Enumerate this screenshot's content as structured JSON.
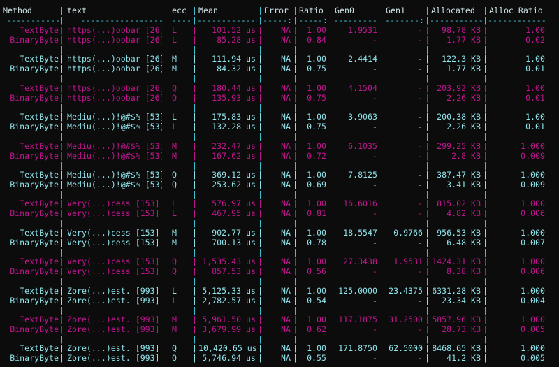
{
  "colors": {
    "background": "#0c0c0c",
    "cyan": "#8fe3ea",
    "magenta": "#c0168e",
    "separator": "#3fc5d0",
    "header": "#cfe3e6"
  },
  "header": [
    "Method",
    "text",
    "ecc",
    "Mean",
    "Error",
    "Ratio",
    "Gen0",
    "Gen1",
    "Allocated",
    "Alloc Ratio"
  ],
  "divider": [
    "-----------",
    "-----------------",
    "----",
    "-------------:",
    "-----:",
    "-----:",
    "---------:",
    "-------:",
    "-----------:",
    "------------:"
  ],
  "groups": [
    {
      "color": "magenta",
      "rows": [
        [
          "TextByte",
          "https(...)oobar [26]",
          "L",
          "101.52 us",
          "NA",
          "1.00",
          "1.9531",
          "-",
          "98.78 KB",
          "1.00"
        ],
        [
          "BinaryByte",
          "https(...)oobar [26]",
          "L",
          "85.28 us",
          "NA",
          "0.84",
          "-",
          "-",
          "1.77 KB",
          "0.02"
        ]
      ]
    },
    {
      "color": "cyan",
      "rows": [
        [
          "TextByte",
          "https(...)oobar [26]",
          "M",
          "111.94 us",
          "NA",
          "1.00",
          "2.4414",
          "-",
          "122.3 KB",
          "1.00"
        ],
        [
          "BinaryByte",
          "https(...)oobar [26]",
          "M",
          "84.32 us",
          "NA",
          "0.75",
          "-",
          "-",
          "1.77 KB",
          "0.01"
        ]
      ]
    },
    {
      "color": "magenta",
      "rows": [
        [
          "TextByte",
          "https(...)oobar [26]",
          "Q",
          "180.44 us",
          "NA",
          "1.00",
          "4.1504",
          "-",
          "203.92 KB",
          "1.00"
        ],
        [
          "BinaryByte",
          "https(...)oobar [26]",
          "Q",
          "135.93 us",
          "NA",
          "0.75",
          "-",
          "-",
          "2.26 KB",
          "0.01"
        ]
      ]
    },
    {
      "color": "cyan",
      "rows": [
        [
          "TextByte",
          "Mediu(...)!@#$% [53]",
          "L",
          "175.83 us",
          "NA",
          "1.00",
          "3.9063",
          "-",
          "200.38 KB",
          "1.00"
        ],
        [
          "BinaryByte",
          "Mediu(...)!@#$% [53]",
          "L",
          "132.28 us",
          "NA",
          "0.75",
          "-",
          "-",
          "2.26 KB",
          "0.01"
        ]
      ]
    },
    {
      "color": "magenta",
      "rows": [
        [
          "TextByte",
          "Mediu(...)!@#$% [53]",
          "M",
          "232.47 us",
          "NA",
          "1.00",
          "6.1035",
          "-",
          "299.25 KB",
          "1.000"
        ],
        [
          "BinaryByte",
          "Mediu(...)!@#$% [53]",
          "M",
          "167.62 us",
          "NA",
          "0.72",
          "-",
          "-",
          "2.8 KB",
          "0.009"
        ]
      ]
    },
    {
      "color": "cyan",
      "rows": [
        [
          "TextByte",
          "Mediu(...)!@#$% [53]",
          "Q",
          "369.12 us",
          "NA",
          "1.00",
          "7.8125",
          "-",
          "387.47 KB",
          "1.000"
        ],
        [
          "BinaryByte",
          "Mediu(...)!@#$% [53]",
          "Q",
          "253.62 us",
          "NA",
          "0.69",
          "-",
          "-",
          "3.41 KB",
          "0.009"
        ]
      ]
    },
    {
      "color": "magenta",
      "rows": [
        [
          "TextByte",
          "Very(...)cess [153]",
          "L",
          "576.97 us",
          "NA",
          "1.00",
          "16.6016",
          "-",
          "815.02 KB",
          "1.000"
        ],
        [
          "BinaryByte",
          "Very(...)cess [153]",
          "L",
          "467.95 us",
          "NA",
          "0.81",
          "-",
          "-",
          "4.82 KB",
          "0.006"
        ]
      ]
    },
    {
      "color": "cyan",
      "rows": [
        [
          "TextByte",
          "Very(...)cess [153]",
          "M",
          "902.77 us",
          "NA",
          "1.00",
          "18.5547",
          "0.9766",
          "956.53 KB",
          "1.000"
        ],
        [
          "BinaryByte",
          "Very(...)cess [153]",
          "M",
          "700.13 us",
          "NA",
          "0.78",
          "-",
          "-",
          "6.48 KB",
          "0.007"
        ]
      ]
    },
    {
      "color": "magenta",
      "rows": [
        [
          "TextByte",
          "Very(...)cess [153]",
          "Q",
          "1,535.43 us",
          "NA",
          "1.00",
          "27.3438",
          "1.9531",
          "1424.31 KB",
          "1.000"
        ],
        [
          "BinaryByte",
          "Very(...)cess [153]",
          "Q",
          "857.53 us",
          "NA",
          "0.56",
          "-",
          "-",
          "8.38 KB",
          "0.006"
        ]
      ]
    },
    {
      "color": "cyan",
      "rows": [
        [
          "TextByte",
          "Zore(...)est. [993]",
          "L",
          "5,125.33 us",
          "NA",
          "1.00",
          "125.0000",
          "23.4375",
          "6331.28 KB",
          "1.000"
        ],
        [
          "BinaryByte",
          "Zore(...)est. [993]",
          "L",
          "2,782.57 us",
          "NA",
          "0.54",
          "-",
          "-",
          "23.34 KB",
          "0.004"
        ]
      ]
    },
    {
      "color": "magenta",
      "rows": [
        [
          "TextByte",
          "Zore(...)est. [993]",
          "M",
          "5,961.50 us",
          "NA",
          "1.00",
          "117.1875",
          "31.2500",
          "5857.96 KB",
          "1.000"
        ],
        [
          "BinaryByte",
          "Zore(...)est. [993]",
          "M",
          "3,679.99 us",
          "NA",
          "0.62",
          "-",
          "-",
          "28.73 KB",
          "0.005"
        ]
      ]
    },
    {
      "color": "cyan",
      "rows": [
        [
          "TextByte",
          "Zore(...)est. [993]",
          "Q",
          "10,420.65 us",
          "NA",
          "1.00",
          "171.8750",
          "62.5000",
          "8468.65 KB",
          "1.000"
        ],
        [
          "BinaryByte",
          "Zore(...)est. [993]",
          "Q",
          "5,746.94 us",
          "NA",
          "0.55",
          "-",
          "-",
          "41.2 KB",
          "0.005"
        ]
      ]
    }
  ]
}
